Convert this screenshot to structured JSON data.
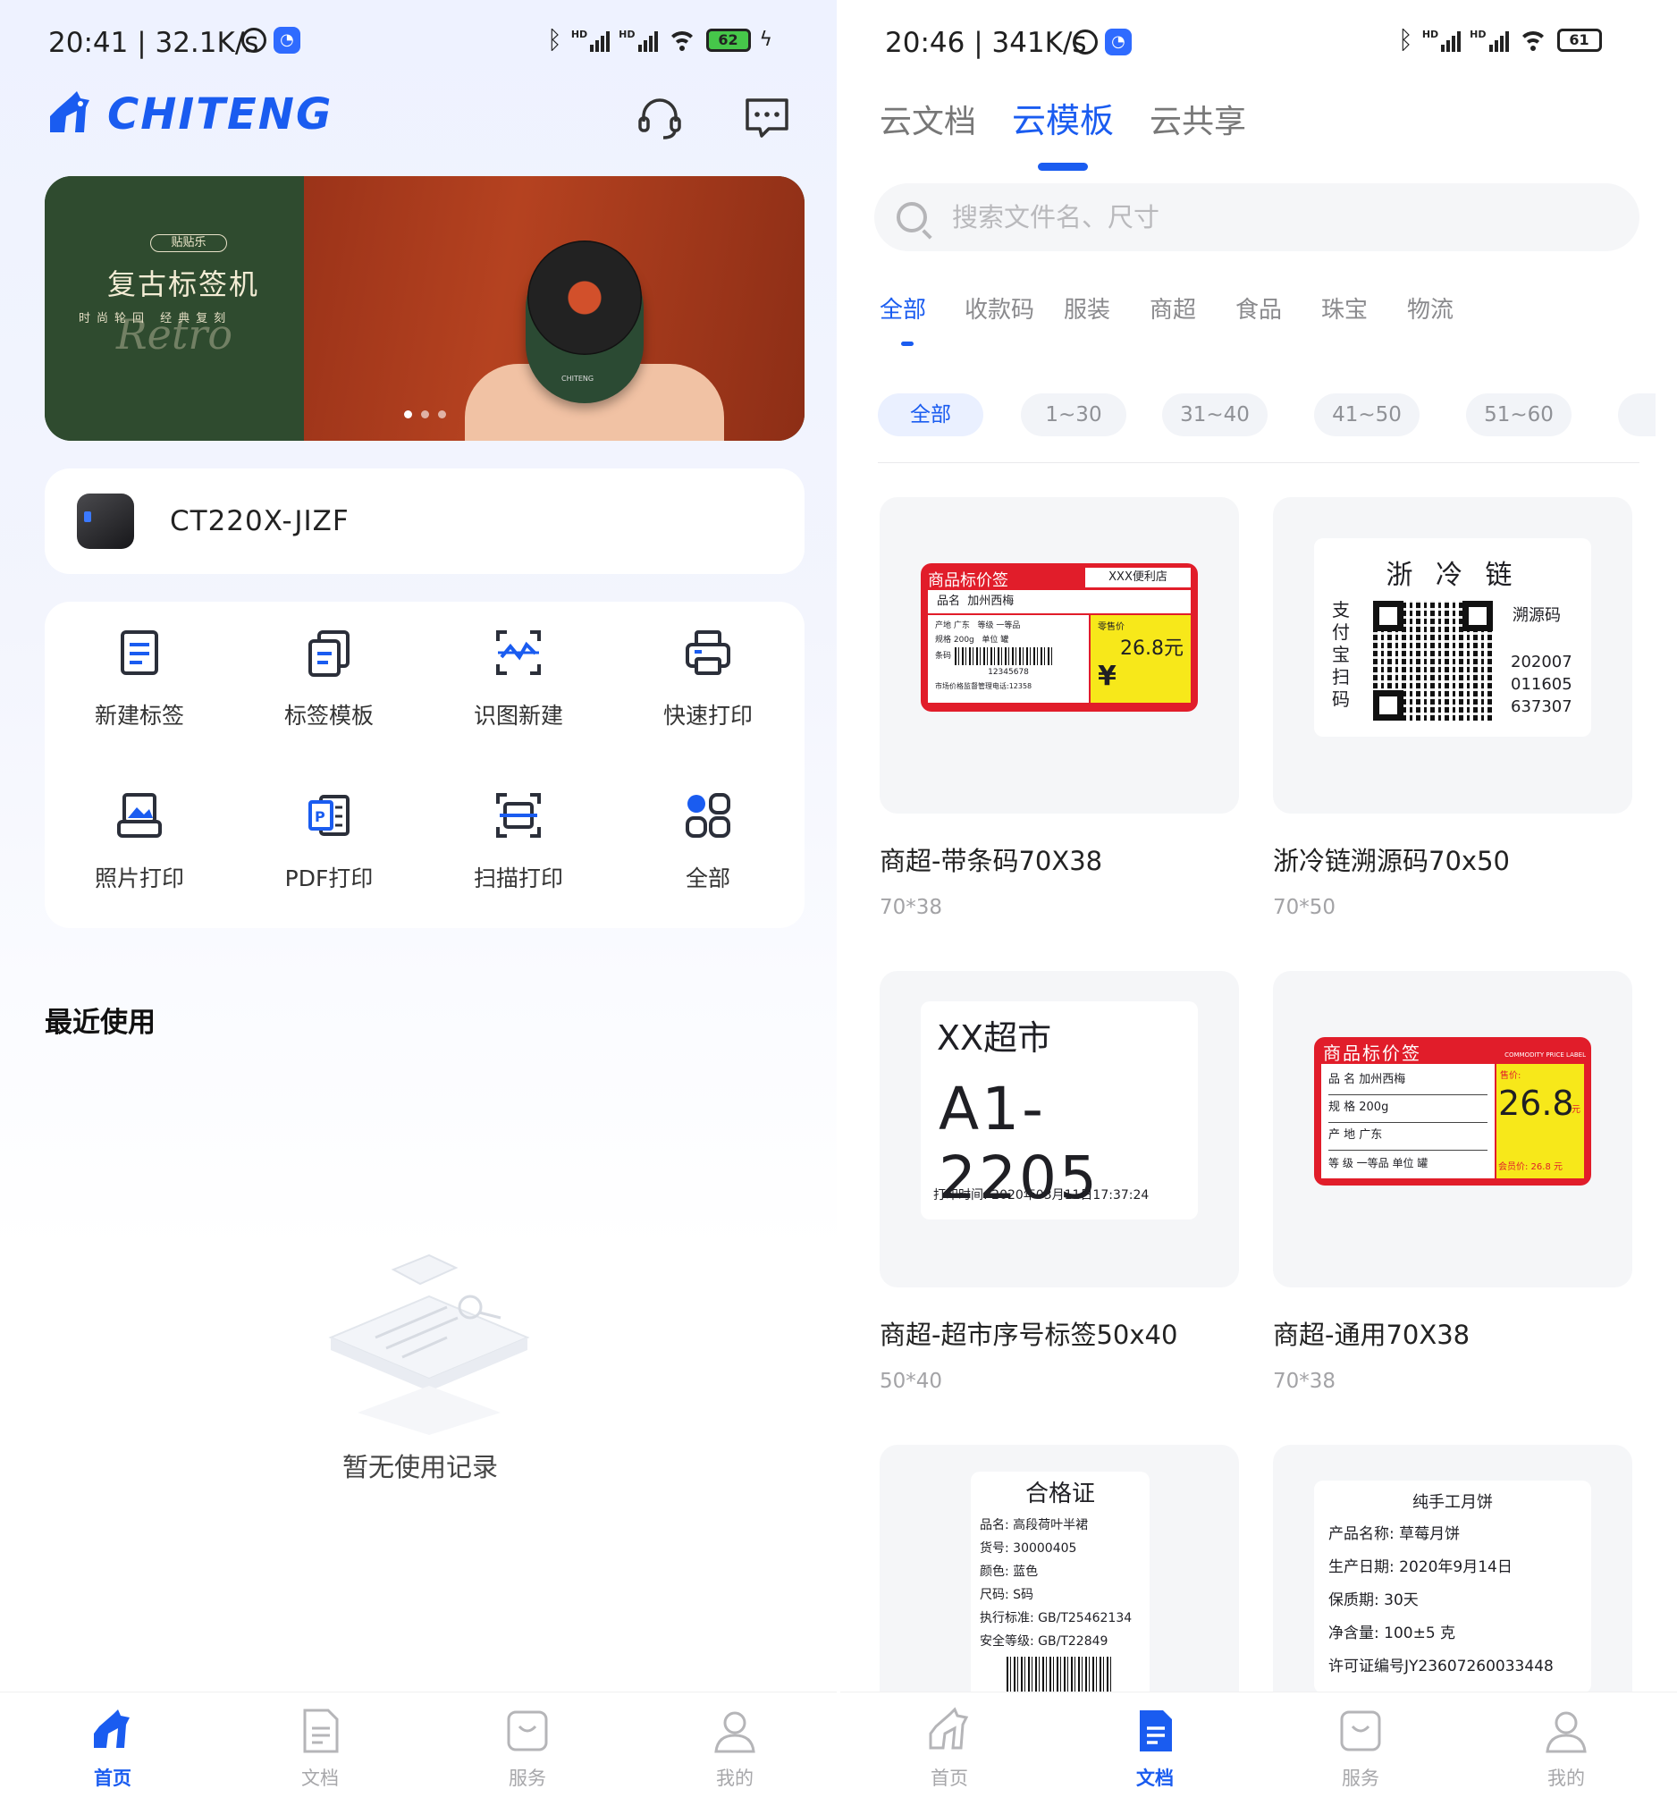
{
  "left": {
    "status": {
      "time": "20:41 | 32.1K/s",
      "battery": "62"
    },
    "brand": "CHITENG",
    "banner": {
      "badge": "贴贴乐",
      "title": "复古标签机",
      "subtitle": "时尚轮回 经典复刻",
      "script": "Retro",
      "device_mark": "CHITENG"
    },
    "device": {
      "name": "CT220X-JIZF"
    },
    "actions": [
      {
        "label": "新建标签",
        "icon": "new-label-icon"
      },
      {
        "label": "标签模板",
        "icon": "label-template-icon"
      },
      {
        "label": "识图新建",
        "icon": "image-recognize-icon"
      },
      {
        "label": "快速打印",
        "icon": "printer-icon"
      },
      {
        "label": "照片打印",
        "icon": "photo-print-icon"
      },
      {
        "label": "PDF打印",
        "icon": "pdf-print-icon"
      },
      {
        "label": "扫描打印",
        "icon": "scan-print-icon"
      },
      {
        "label": "全部",
        "icon": "all-apps-icon"
      }
    ],
    "recent_title": "最近使用",
    "empty_text": "暂无使用记录",
    "nav": [
      {
        "label": "首页"
      },
      {
        "label": "文档"
      },
      {
        "label": "服务"
      },
      {
        "label": "我的"
      }
    ]
  },
  "right": {
    "status": {
      "time": "20:46 | 341K/s",
      "battery": "61"
    },
    "tabs": [
      {
        "label": "云文档"
      },
      {
        "label": "云模板"
      },
      {
        "label": "云共享"
      }
    ],
    "search_placeholder": "搜索文件名、尺寸",
    "categories": [
      {
        "label": "全部"
      },
      {
        "label": "收款码"
      },
      {
        "label": "服装"
      },
      {
        "label": "商超"
      },
      {
        "label": "食品"
      },
      {
        "label": "珠宝"
      },
      {
        "label": "物流"
      }
    ],
    "size_filters": [
      {
        "label": "全部"
      },
      {
        "label": "1~30"
      },
      {
        "label": "31~40"
      },
      {
        "label": "41~50"
      },
      {
        "label": "51~60"
      }
    ],
    "templates": [
      {
        "name": "商超-带条码70X38",
        "size": "70*38",
        "preview": {
          "header": "商品标价签",
          "store": "XXX便利店",
          "product_label": "品名",
          "product": "加州西梅",
          "origin": "产地 广东",
          "grade": "等级 一等品",
          "spec": "规格 200g",
          "unit": "单位 罐",
          "barcode_label": "条码",
          "barcode_num": "12345678",
          "price_label": "零售价",
          "price": "26.8元",
          "yen": "¥",
          "footer": "市场价格监督管理电话:12358"
        }
      },
      {
        "name": "浙冷链溯源码70x50",
        "size": "70*50",
        "preview": {
          "title": "浙 冷 链",
          "side": "支付宝扫码",
          "code_label": "溯源码",
          "code": [
            "202007",
            "011605",
            "637307"
          ]
        }
      },
      {
        "name": "商超-超市序号标签50x40",
        "size": "50*40",
        "preview": {
          "title": "XX超市",
          "number": "A1-2205",
          "print_time": "打印时间: 2020年03月11日17:37:24"
        }
      },
      {
        "name": "商超-通用70X38",
        "size": "70*38",
        "preview": {
          "header": "商品标价签",
          "header_en": "COMMODITY PRICE LABEL",
          "rows": [
            "品 名  加州西梅",
            "规 格  200g",
            "产 地  广东",
            "等 级  一等品  单位 罐"
          ],
          "price_label": "售价:",
          "price": "26.8",
          "price_unit": "元",
          "member": "会员价: 26.8 元"
        }
      },
      {
        "name": "",
        "size": "",
        "preview": {
          "title": "合格证",
          "lines": [
            "品名: 高段荷叶半裙",
            "货号: 30000405",
            "颜色: 蓝色",
            "尺码: S码",
            "执行标准: GB/T25462134",
            "安全等级: GB/T22849"
          ]
        }
      },
      {
        "name": "",
        "size": "",
        "preview": {
          "title": "纯手工月饼",
          "lines": [
            "产品名称: 草莓月饼",
            "生产日期: 2020年9月14日",
            "保质期: 30天",
            "净含量: 100±5 克",
            "许可证编号JY23607260033448"
          ]
        }
      }
    ],
    "nav": [
      {
        "label": "首页"
      },
      {
        "label": "文档"
      },
      {
        "label": "服务"
      },
      {
        "label": "我的"
      }
    ]
  },
  "colors": {
    "brand": "#1a5cf0",
    "price_red": "#e11d2a",
    "price_yellow": "#f7e81a"
  }
}
